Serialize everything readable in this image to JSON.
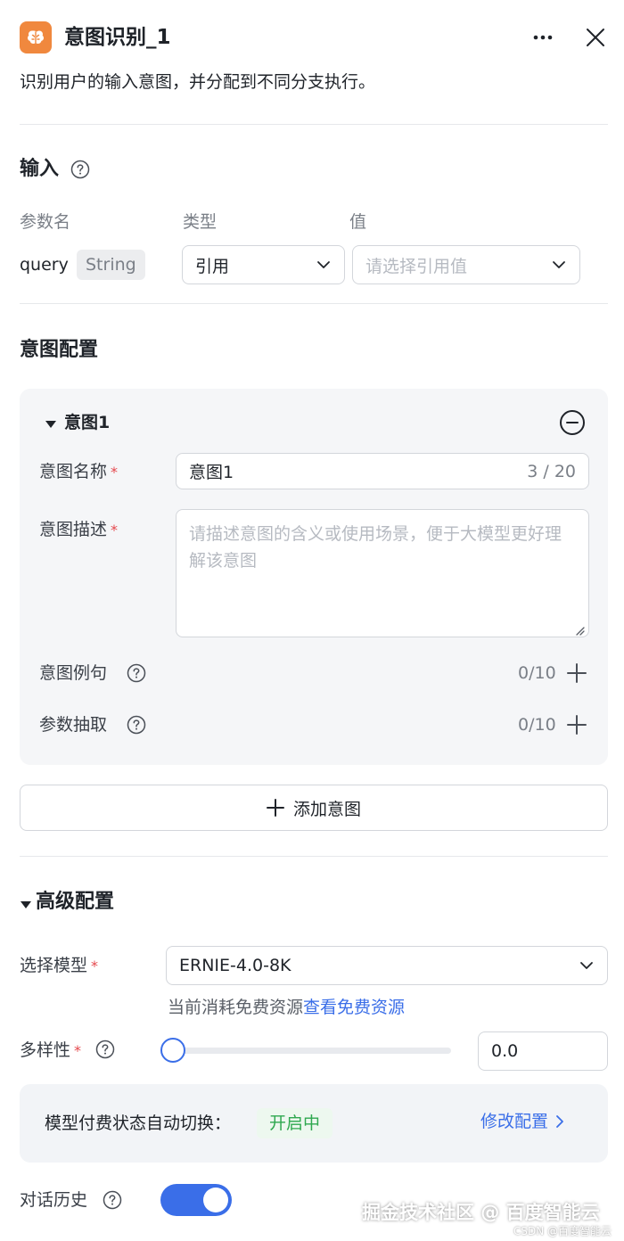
{
  "header": {
    "icon": "brain-icon",
    "title": "意图识别_1",
    "description": "识别用户的输入意图，并分配到不同分支执行。"
  },
  "input_section": {
    "title": "输入",
    "columns": {
      "name": "参数名",
      "type": "类型",
      "value": "值"
    },
    "row": {
      "param_name": "query",
      "param_type": "String",
      "type_value": "引用",
      "value_placeholder": "请选择引用值"
    }
  },
  "intent_section": {
    "title": "意图配置",
    "intent": {
      "header_label": "意图1",
      "name_label": "意图名称",
      "name_value": "意图1",
      "name_count": "3 / 20",
      "desc_label": "意图描述",
      "desc_placeholder": "请描述意图的含义或使用场景，便于大模型更好理解该意图",
      "examples_label": "意图例句",
      "examples_count": "0/10",
      "params_label": "参数抽取",
      "params_count": "0/10"
    },
    "add_button": "添加意图"
  },
  "advanced_section": {
    "title": "高级配置",
    "model_label": "选择模型",
    "model_value": "ERNIE-4.0-8K",
    "resource_text": "当前消耗免费资源",
    "resource_link": "查看免费资源",
    "diversity_label": "多样性",
    "diversity_value": "0.0",
    "diversity_level": 0.0,
    "billing_label": "模型付费状态自动切换：",
    "billing_status": "开启中",
    "billing_link": "修改配置",
    "history_label": "对话历史",
    "history_enabled": true
  },
  "watermark": {
    "main": "掘金技术社区 @ 百度智能云",
    "sub": "CSDN @百度智能云"
  },
  "colors": {
    "accent": "#3a6ee8",
    "icon_orange": "#f0883e",
    "required": "#e5484d",
    "status_green": "#2fa84f"
  }
}
